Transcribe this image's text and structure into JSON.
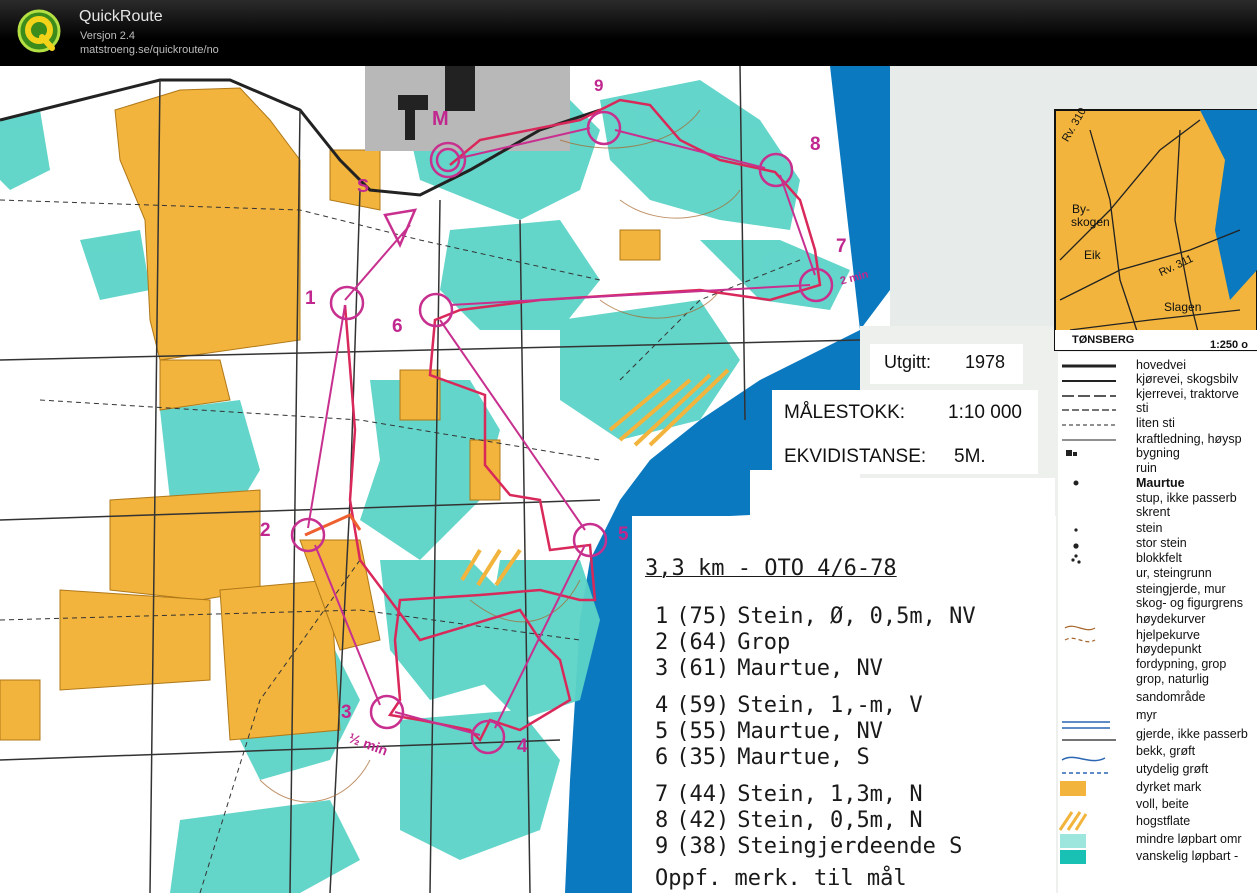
{
  "app": {
    "title": "QuickRoute",
    "version": "Versjon 2.4",
    "url": "matstroeng.se/quickroute/no"
  },
  "colors": {
    "open_land": "#f2b43c",
    "vegetation": "#5cd3c7",
    "water": "#0b79c0",
    "course": "#c8308f",
    "route": "#d9285a",
    "building": "#8c8c8c"
  },
  "map_info": {
    "published_label": "Utgitt:",
    "published_year": "1978",
    "scale_label": "MÅLESTOKK:",
    "scale_value": "1:10 000",
    "contour_label": "EKVIDISTANSE:",
    "contour_value": "5M."
  },
  "inset": {
    "places": [
      "By-",
      "skogen",
      "Eik",
      "Slagen",
      "TØNSBERG"
    ],
    "roads": [
      "Rv. 310",
      "Rv. 311"
    ],
    "scale": "1:250 o"
  },
  "course": {
    "header": "3,3 km - OTO 4/6-78",
    "controls": [
      {
        "num": "1",
        "code": "(75)",
        "desc": "Stein, Ø, 0,5m, NV"
      },
      {
        "num": "2",
        "code": "(64)",
        "desc": "Grop"
      },
      {
        "num": "3",
        "code": "(61)",
        "desc": "Maurtue, NV"
      },
      {
        "num": "4",
        "code": "(59)",
        "desc": "Stein, 1,-m, V"
      },
      {
        "num": "5",
        "code": "(55)",
        "desc": "Maurtue, NV"
      },
      {
        "num": "6",
        "code": "(35)",
        "desc": "Maurtue, S"
      },
      {
        "num": "7",
        "code": "(44)",
        "desc": "Stein, 1,3m, N"
      },
      {
        "num": "8",
        "code": "(42)",
        "desc": "Stein, 0,5m, N"
      },
      {
        "num": "9",
        "code": "(38)",
        "desc": "Steingjerdeende S"
      }
    ],
    "footer": "Oppf. merk. til mål"
  },
  "map_marks": {
    "start": "S",
    "finish": "M",
    "control_numbers": [
      "1",
      "2",
      "3",
      "4",
      "5",
      "6",
      "7",
      "8",
      "9"
    ],
    "notes": [
      "½ min",
      "2 min"
    ]
  },
  "legend": [
    {
      "label": "hovedvei",
      "symbol": "main-road"
    },
    {
      "label": "kjørevei, skogsbilv",
      "symbol": "road"
    },
    {
      "label": "kjerrevei, traktorve",
      "symbol": "track"
    },
    {
      "label": "sti",
      "symbol": "path"
    },
    {
      "label": "liten sti",
      "symbol": "small-path"
    },
    {
      "label": "kraftledning, høysp",
      "symbol": "power-line"
    },
    {
      "label": "bygning",
      "symbol": "building"
    },
    {
      "label": "ruin",
      "symbol": "ruin"
    },
    {
      "label": "Maurtue",
      "symbol": "anthill"
    },
    {
      "label": "stup, ikke passerb",
      "symbol": "cliff"
    },
    {
      "label": "skrent",
      "symbol": "rock-face"
    },
    {
      "label": "stein",
      "symbol": "boulder"
    },
    {
      "label": "stor stein",
      "symbol": "large-boulder"
    },
    {
      "label": "blokkfelt",
      "symbol": "boulder-field"
    },
    {
      "label": "ur, steingrunn",
      "symbol": "stony-ground"
    },
    {
      "label": "steingjerde, mur",
      "symbol": "stone-wall"
    },
    {
      "label": "skog- og figurgrens",
      "symbol": "boundary"
    },
    {
      "label": "høydekurver",
      "symbol": "contour"
    },
    {
      "label": "hjelpekurve",
      "symbol": "form-line"
    },
    {
      "label": "høydepunkt",
      "symbol": "knoll"
    },
    {
      "label": "fordypning, grop",
      "symbol": "depression"
    },
    {
      "label": "grop, naturlig",
      "symbol": "pit"
    },
    {
      "label": "sandområde",
      "symbol": "sand"
    },
    {
      "label": "myr",
      "symbol": "marsh"
    },
    {
      "label": "gjerde, ikke passerb",
      "symbol": "fence"
    },
    {
      "label": "bekk, grøft",
      "symbol": "stream"
    },
    {
      "label": "utydelig grøft",
      "symbol": "ditch"
    },
    {
      "label": "dyrket mark",
      "symbol": "cultivated"
    },
    {
      "label": "voll, beite",
      "symbol": "pasture"
    },
    {
      "label": "hogstflate",
      "symbol": "clearing"
    },
    {
      "label": "mindre løpbart omr",
      "symbol": "slow-run"
    },
    {
      "label": "vanskelig løpbart -",
      "symbol": "difficult-run"
    }
  ]
}
